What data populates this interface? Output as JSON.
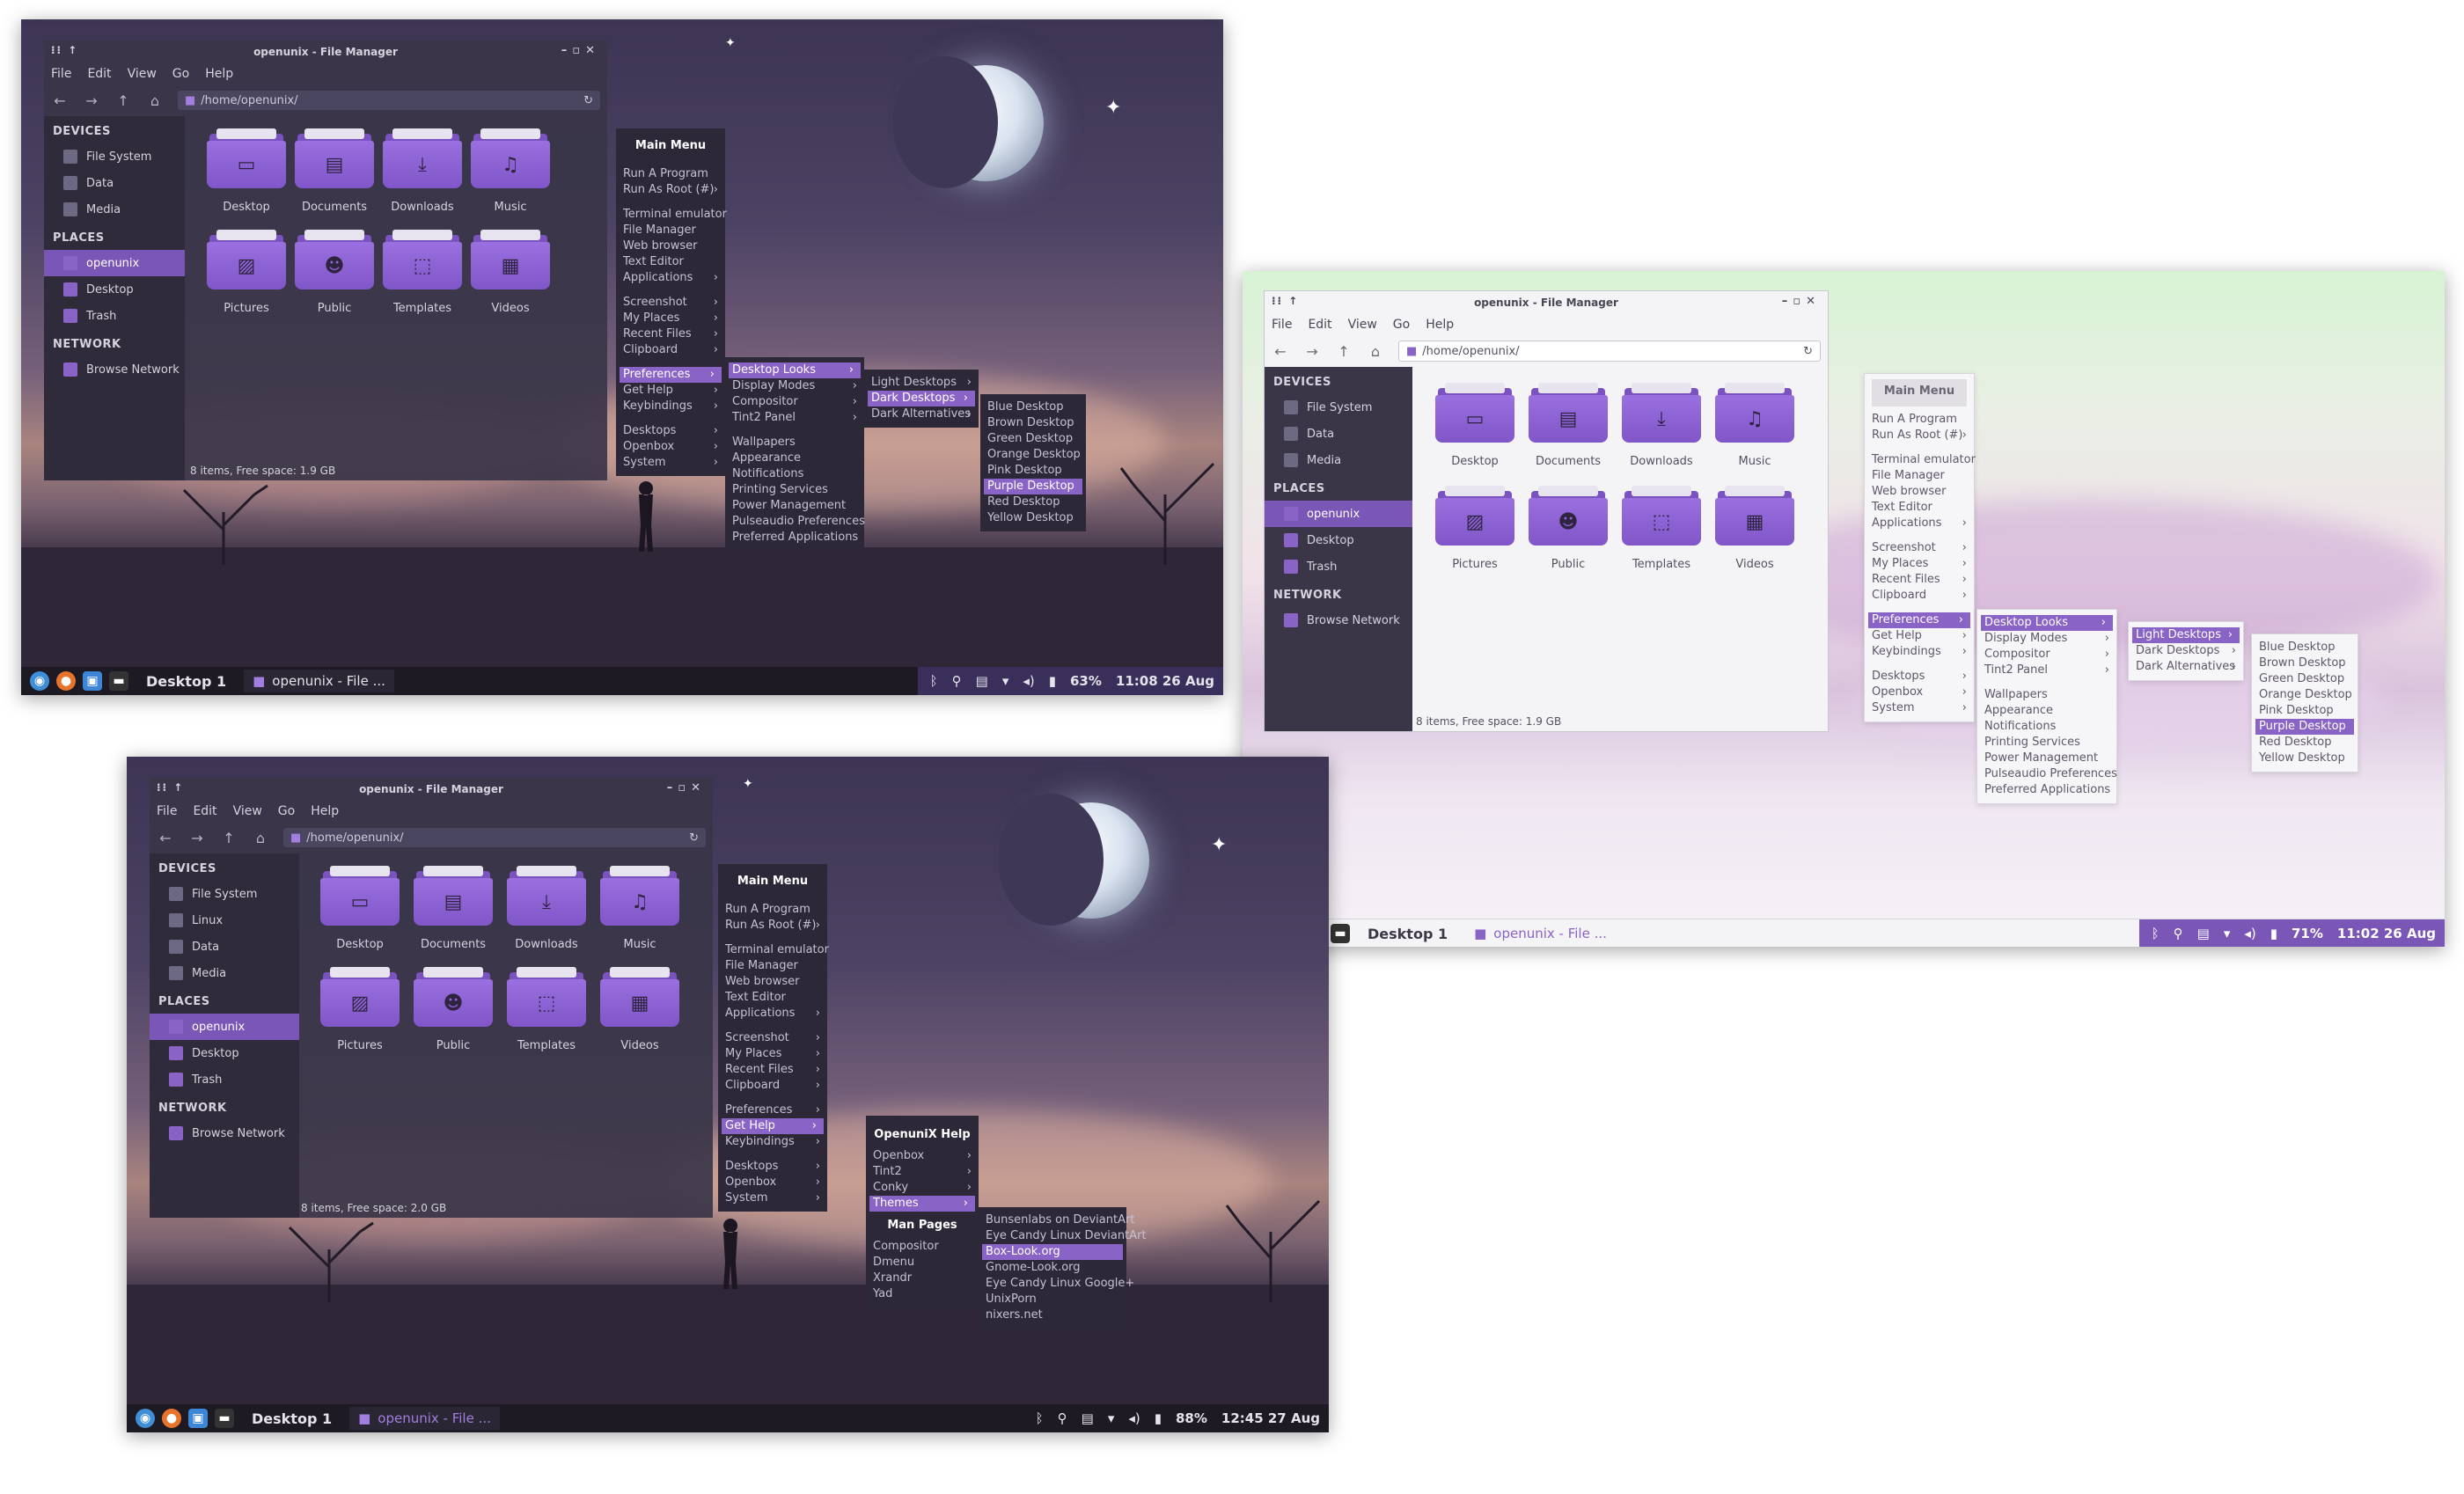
{
  "top_left": {
    "fm": {
      "title": "openunix - File Manager",
      "menu": [
        "File",
        "Edit",
        "View",
        "Go",
        "Help"
      ],
      "path": "/home/openunix/",
      "sidebar": [
        {
          "header": "DEVICES",
          "items": [
            {
              "label": "File System",
              "selected": false
            },
            {
              "label": "Data",
              "selected": false
            },
            {
              "label": "Media",
              "selected": false
            }
          ]
        },
        {
          "header": "PLACES",
          "items": [
            {
              "label": "openunix",
              "selected": true
            },
            {
              "label": "Desktop",
              "selected": false
            },
            {
              "label": "Trash",
              "selected": false
            }
          ]
        },
        {
          "header": "NETWORK",
          "items": [
            {
              "label": "Browse Network",
              "selected": false
            }
          ]
        }
      ],
      "folders": [
        "Desktop",
        "Documents",
        "Downloads",
        "Music",
        "Pictures",
        "Public",
        "Templates",
        "Videos"
      ],
      "status": "8 items, Free space: 1.9 GB"
    },
    "main_menu": {
      "title": "Main Menu",
      "groups": [
        [
          "Run A Program",
          "Run As Root (#)"
        ],
        [
          "Terminal emulator",
          "File Manager",
          "Web browser",
          "Text Editor",
          "Applications"
        ],
        [
          "Screenshot",
          "My Places",
          "Recent Files",
          "Clipboard"
        ],
        [
          "Preferences",
          "Get Help",
          "Keybindings"
        ],
        [
          "Desktops",
          "Openbox",
          "System"
        ]
      ],
      "submenu_items": [
        "Run As Root (#)",
        "Applications",
        "Screenshot",
        "My Places",
        "Recent Files",
        "Clipboard",
        "Preferences",
        "Get Help",
        "Keybindings",
        "Desktops",
        "Openbox",
        "System"
      ],
      "selected": "Preferences"
    },
    "prefs_menu": {
      "groups": [
        [
          "Desktop Looks",
          "Display Modes",
          "Compositor",
          "Tint2 Panel"
        ],
        [
          "Wallpapers",
          "Appearance",
          "Notifications",
          "Printing Services",
          "Power Management",
          "Pulseaudio Preferences",
          "Preferred Applications"
        ]
      ],
      "submenu_items": [
        "Desktop Looks",
        "Display Modes",
        "Compositor",
        "Tint2 Panel"
      ],
      "selected": "Desktop Looks"
    },
    "looks_menu": {
      "items": [
        "Light Desktops",
        "Dark Desktops",
        "Dark Alternatives"
      ],
      "selected": "Dark Desktops"
    },
    "colors_menu": {
      "items": [
        "Blue Desktop",
        "Brown Desktop",
        "Green Desktop",
        "Orange Desktop",
        "Pink Desktop",
        "Purple Desktop",
        "Red Desktop",
        "Yellow Desktop"
      ],
      "selected": "Purple Desktop"
    },
    "taskbar": {
      "desktop": "Desktop 1",
      "task": "openunix - File ...",
      "battery": "63%",
      "clock": "11:08 26 Aug"
    }
  },
  "right": {
    "fm": {
      "title": "openunix - File Manager",
      "menu": [
        "File",
        "Edit",
        "View",
        "Go",
        "Help"
      ],
      "path": "/home/openunix/",
      "sidebar": [
        {
          "header": "DEVICES",
          "items": [
            {
              "label": "File System",
              "selected": false
            },
            {
              "label": "Data",
              "selected": false
            },
            {
              "label": "Media",
              "selected": false
            }
          ]
        },
        {
          "header": "PLACES",
          "items": [
            {
              "label": "openunix",
              "selected": true
            },
            {
              "label": "Desktop",
              "selected": false
            },
            {
              "label": "Trash",
              "selected": false
            }
          ]
        },
        {
          "header": "NETWORK",
          "items": [
            {
              "label": "Browse Network",
              "selected": false
            }
          ]
        }
      ],
      "folders": [
        "Desktop",
        "Documents",
        "Downloads",
        "Music",
        "Pictures",
        "Public",
        "Templates",
        "Videos"
      ],
      "status": "8 items, Free space: 1.9 GB"
    },
    "main_menu": {
      "title": "Main Menu",
      "groups": [
        [
          "Run A Program",
          "Run As Root (#)"
        ],
        [
          "Terminal emulator",
          "File Manager",
          "Web browser",
          "Text Editor",
          "Applications"
        ],
        [
          "Screenshot",
          "My Places",
          "Recent Files",
          "Clipboard"
        ],
        [
          "Preferences",
          "Get Help",
          "Keybindings"
        ],
        [
          "Desktops",
          "Openbox",
          "System"
        ]
      ],
      "submenu_items": [
        "Run As Root (#)",
        "Applications",
        "Screenshot",
        "My Places",
        "Recent Files",
        "Clipboard",
        "Preferences",
        "Get Help",
        "Keybindings",
        "Desktops",
        "Openbox",
        "System"
      ],
      "selected": "Preferences"
    },
    "prefs_menu": {
      "groups": [
        [
          "Desktop Looks",
          "Display Modes",
          "Compositor",
          "Tint2 Panel"
        ],
        [
          "Wallpapers",
          "Appearance",
          "Notifications",
          "Printing Services",
          "Power Management",
          "Pulseaudio Preferences",
          "Preferred Applications"
        ]
      ],
      "submenu_items": [
        "Desktop Looks",
        "Display Modes",
        "Compositor",
        "Tint2 Panel"
      ],
      "selected": "Desktop Looks"
    },
    "looks_menu": {
      "items": [
        "Light Desktops",
        "Dark Desktops",
        "Dark Alternatives"
      ],
      "selected": "Light Desktops"
    },
    "colors_menu": {
      "items": [
        "Blue Desktop",
        "Brown Desktop",
        "Green Desktop",
        "Orange Desktop",
        "Pink Desktop",
        "Purple Desktop",
        "Red Desktop",
        "Yellow Desktop"
      ],
      "selected": "Purple Desktop"
    },
    "taskbar": {
      "desktop": "Desktop 1",
      "task": "openunix - File ...",
      "battery": "71%",
      "clock": "11:02 26 Aug"
    }
  },
  "bottom_left": {
    "fm": {
      "title": "openunix - File Manager",
      "menu": [
        "File",
        "Edit",
        "View",
        "Go",
        "Help"
      ],
      "path": "/home/openunix/",
      "sidebar": [
        {
          "header": "DEVICES",
          "items": [
            {
              "label": "File System",
              "selected": false
            },
            {
              "label": "Linux",
              "selected": false
            },
            {
              "label": "Data",
              "selected": false
            },
            {
              "label": "Media",
              "selected": false
            }
          ]
        },
        {
          "header": "PLACES",
          "items": [
            {
              "label": "openunix",
              "selected": true
            },
            {
              "label": "Desktop",
              "selected": false
            },
            {
              "label": "Trash",
              "selected": false
            }
          ]
        },
        {
          "header": "NETWORK",
          "items": [
            {
              "label": "Browse Network",
              "selected": false
            }
          ]
        }
      ],
      "folders": [
        "Desktop",
        "Documents",
        "Downloads",
        "Music",
        "Pictures",
        "Public",
        "Templates",
        "Videos"
      ],
      "status": "8 items, Free space: 2.0 GB"
    },
    "main_menu": {
      "title": "Main Menu",
      "groups": [
        [
          "Run A Program",
          "Run As Root (#)"
        ],
        [
          "Terminal emulator",
          "File Manager",
          "Web browser",
          "Text Editor",
          "Applications"
        ],
        [
          "Screenshot",
          "My Places",
          "Recent Files",
          "Clipboard"
        ],
        [
          "Preferences",
          "Get Help",
          "Keybindings"
        ],
        [
          "Desktops",
          "Openbox",
          "System"
        ]
      ],
      "submenu_items": [
        "Run As Root (#)",
        "Applications",
        "Screenshot",
        "My Places",
        "Recent Files",
        "Clipboard",
        "Preferences",
        "Get Help",
        "Keybindings",
        "Desktops",
        "Openbox",
        "System"
      ],
      "selected": "Get Help"
    },
    "help_menu": {
      "title": "OpenuniX Help",
      "items": [
        "Openbox",
        "Tint2",
        "Conky",
        "Themes"
      ],
      "selected": "Themes",
      "man_title": "Man Pages",
      "man_items": [
        "Compositor",
        "Dmenu",
        "Xrandr",
        "Yad"
      ]
    },
    "themes_menu": {
      "items": [
        "Bunsenlabs on DeviantArt",
        "Eye Candy Linux DeviantArt",
        "Box-Look.org",
        "Gnome-Look.org",
        "Eye Candy Linux Google+",
        "UnixPorn",
        "nixers.net"
      ],
      "selected": "Box-Look.org"
    },
    "taskbar": {
      "desktop": "Desktop 1",
      "task": "openunix - File ...",
      "battery": "88%",
      "clock": "12:45 27 Aug"
    }
  },
  "colors": {
    "accent": "#8a63c7",
    "folder": "#8056c8",
    "dark_panel": "#2c2838"
  }
}
